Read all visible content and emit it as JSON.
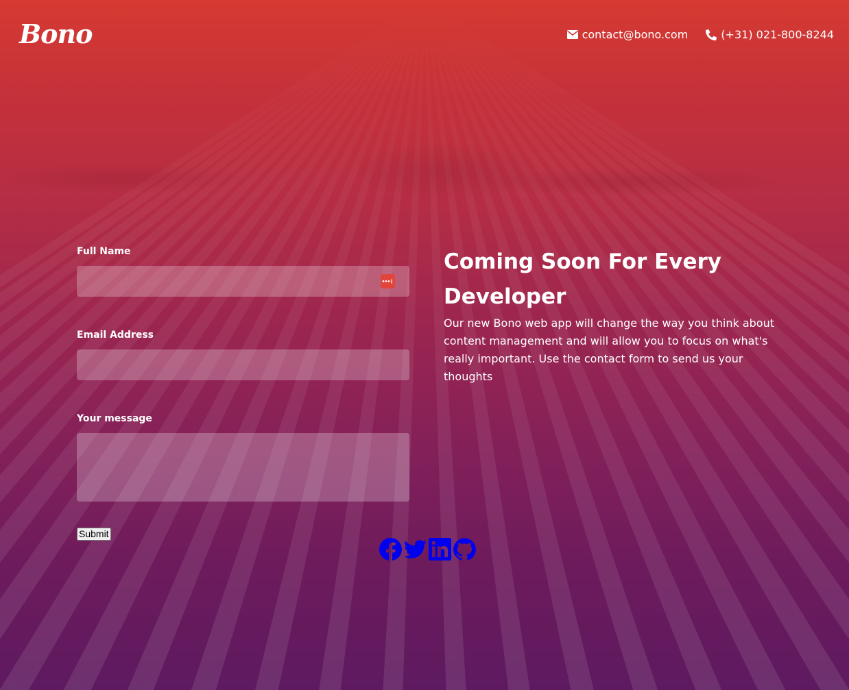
{
  "brand": {
    "logo_text": "Bono"
  },
  "header": {
    "email": "contact@bono.com",
    "phone": "(+31) 021-800-8244"
  },
  "form": {
    "name_label": "Full Name",
    "name_value": "",
    "email_label": "Email Address",
    "email_value": "",
    "message_label": "Your message",
    "message_value": "",
    "submit_label": "Submit"
  },
  "hero": {
    "title": "Coming Soon For Every Developer",
    "body": "Our new Bono web app will change the way you think about content management and will allow you to focus on what's really important. Use the contact form to send us your thoughts"
  },
  "social": {
    "links": [
      "facebook-icon",
      "twitter-icon",
      "linkedin-icon",
      "github-icon"
    ],
    "link_color": "#0000ee"
  },
  "colors": {
    "gradient_top": "#d63a31",
    "gradient_bottom": "#5e1a60",
    "password_badge": "#e2453c"
  }
}
